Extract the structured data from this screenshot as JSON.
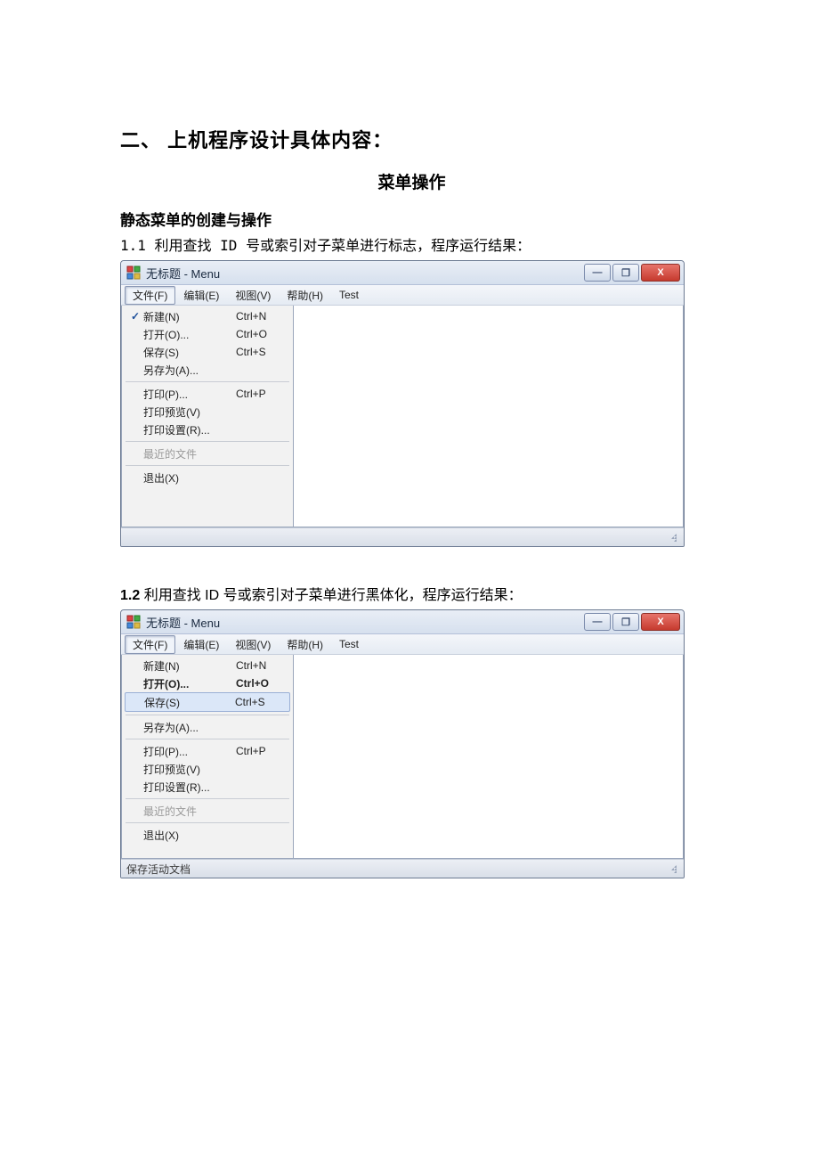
{
  "doc": {
    "heading": "二、 上机程序设计具体内容：",
    "subheading": "菜单操作",
    "section": "静态菜单的创建与操作",
    "cap1_prefix": "1.1 利用查找 ID 号或索引对子菜单进行标志，程序运行结果：",
    "cap2_prefix_a": "1.2",
    "cap2_prefix_b": " 利用查找 ID 号或索引对子菜单进行黑体化，程序运行结果："
  },
  "window": {
    "title": "无标题 - Menu",
    "btn_min": "—",
    "btn_max": "❐",
    "btn_close": "X"
  },
  "menubar": {
    "items": [
      "文件(F)",
      "编辑(E)",
      "视图(V)",
      "帮助(H)",
      "Test"
    ]
  },
  "dropdown1": {
    "items": [
      {
        "check": "✓",
        "label": "新建(N)",
        "accel": "Ctrl+N"
      },
      {
        "check": "",
        "label": "打开(O)...",
        "accel": "Ctrl+O"
      },
      {
        "check": "",
        "label": "保存(S)",
        "accel": "Ctrl+S"
      },
      {
        "check": "",
        "label": "另存为(A)...",
        "accel": ""
      },
      {
        "sep": true
      },
      {
        "check": "",
        "label": "打印(P)...",
        "accel": "Ctrl+P"
      },
      {
        "check": "",
        "label": "打印预览(V)",
        "accel": ""
      },
      {
        "check": "",
        "label": "打印设置(R)...",
        "accel": ""
      },
      {
        "sep": true
      },
      {
        "check": "",
        "label": "最近的文件",
        "accel": "",
        "disabled": true
      },
      {
        "sep": true
      },
      {
        "check": "",
        "label": "退出(X)",
        "accel": ""
      }
    ]
  },
  "dropdown2": {
    "items": [
      {
        "label": "新建(N)",
        "accel": "Ctrl+N"
      },
      {
        "label": "打开(O)...",
        "accel": "Ctrl+O",
        "bold": true
      },
      {
        "label": "保存(S)",
        "accel": "Ctrl+S",
        "hl": true
      },
      {
        "sep": true
      },
      {
        "label": "另存为(A)...",
        "accel": ""
      },
      {
        "sep": true
      },
      {
        "label": "打印(P)...",
        "accel": "Ctrl+P"
      },
      {
        "label": "打印预览(V)",
        "accel": ""
      },
      {
        "label": "打印设置(R)...",
        "accel": ""
      },
      {
        "sep": true
      },
      {
        "label": "最近的文件",
        "accel": "",
        "disabled": true
      },
      {
        "sep": true
      },
      {
        "label": "退出(X)",
        "accel": ""
      }
    ],
    "status": "保存活动文档"
  }
}
